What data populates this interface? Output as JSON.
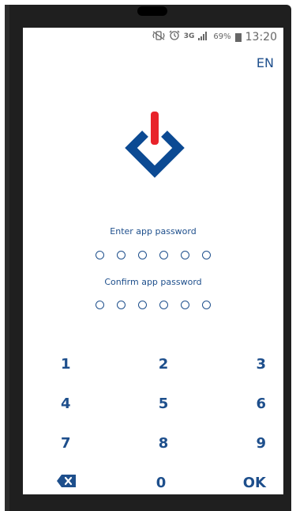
{
  "status_bar": {
    "network_type": "3G",
    "battery_percent": "69%",
    "time": "13:20",
    "icons": [
      "mute-vibrate-icon",
      "alarm-icon",
      "network-3g-icon",
      "signal-icon",
      "battery-icon"
    ]
  },
  "language": {
    "label": "EN"
  },
  "logo": {
    "icon": "power-diamond-logo-icon",
    "colors": {
      "diamond": "#0c4a93",
      "bar": "#e8232a"
    }
  },
  "password": {
    "enter_label": "Enter app password",
    "confirm_label": "Confirm app password",
    "digits_count_enter": 6,
    "digits_count_confirm": 6
  },
  "keypad": {
    "rows": [
      [
        "1",
        "2",
        "3"
      ],
      [
        "4",
        "5",
        "6"
      ],
      [
        "7",
        "8",
        "9"
      ],
      [
        "",
        "0",
        "OK"
      ]
    ],
    "backspace_icon": "backspace-icon"
  },
  "colors": {
    "accent": "#1e4f8c",
    "phone_frame": "#1f1f1f",
    "background": "#ffffff"
  }
}
